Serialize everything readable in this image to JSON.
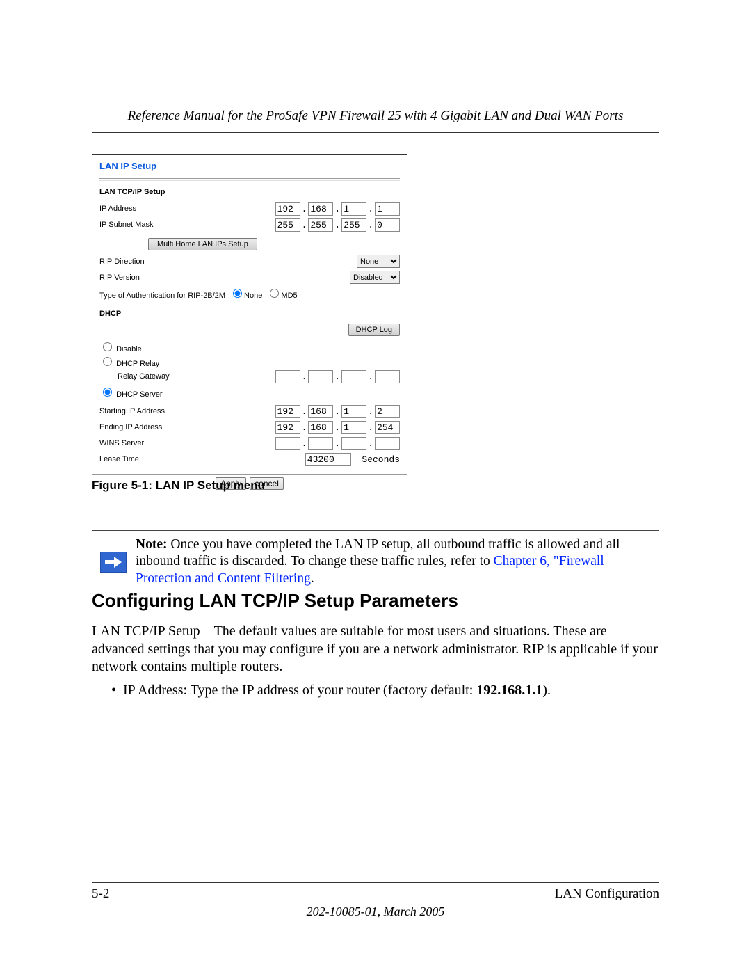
{
  "header": {
    "running": "Reference Manual for the ProSafe VPN Firewall 25 with 4 Gigabit LAN and Dual WAN Ports"
  },
  "panel": {
    "title": "LAN IP Setup",
    "section1": "LAN TCP/IP Setup",
    "ip_addr_lbl": "IP Address",
    "ip_addr": [
      "192",
      "168",
      "1",
      "1"
    ],
    "subnet_lbl": "IP Subnet Mask",
    "subnet": [
      "255",
      "255",
      "255",
      "0"
    ],
    "multi_btn": "Multi Home LAN IPs Setup",
    "rip_dir_lbl": "RIP Direction",
    "rip_dir_val": "None",
    "rip_ver_lbl": "RIP Version",
    "rip_ver_val": "Disabled",
    "auth_lbl": "Type of Authentication for RIP-2B/2M",
    "auth_none": "None",
    "auth_md5": "MD5",
    "dhcp_head": "DHCP",
    "dhcp_log_btn": "DHCP Log",
    "dhcp_disable": "Disable",
    "dhcp_relay": "DHCP Relay",
    "relay_gw_lbl": "Relay Gateway",
    "relay_gw": [
      "",
      "",
      "",
      ""
    ],
    "dhcp_server": "DHCP Server",
    "start_lbl": "Starting IP Address",
    "start_ip": [
      "192",
      "168",
      "1",
      "2"
    ],
    "end_lbl": "Ending IP Address",
    "end_ip": [
      "192",
      "168",
      "1",
      "254"
    ],
    "wins_lbl": "WINS Server",
    "wins_ip": [
      "",
      "",
      "",
      ""
    ],
    "lease_lbl": "Lease Time",
    "lease_val": "43200",
    "lease_unit": "Seconds",
    "apply_btn": "Apply",
    "cancel_btn": "cancel",
    "fig_caption": "Figure 5-1:  LAN IP Setup menu"
  },
  "note": {
    "lead": "Note:",
    "text_a": " Once you have completed the LAN IP setup, all outbound traffic is allowed and all inbound traffic is discarded. To change these traffic rules, refer to ",
    "link": "Chapter 6, \"Firewall Protection and Content Filtering",
    "tail": "."
  },
  "h2": "Configuring LAN TCP/IP Setup Parameters",
  "para": "LAN TCP/IP Setup—The default values are suitable for most users and situations. These are advanced settings that you may configure if you are a network administrator. RIP is applicable if your network contains multiple routers.",
  "bullet_text": "IP Address: Type the IP address of your router (factory default: ",
  "bullet_val": "192.168.1.1",
  "bullet_end": ").",
  "footer": {
    "left": "5-2",
    "right": "LAN Configuration",
    "center": "202-10085-01, March 2005"
  }
}
